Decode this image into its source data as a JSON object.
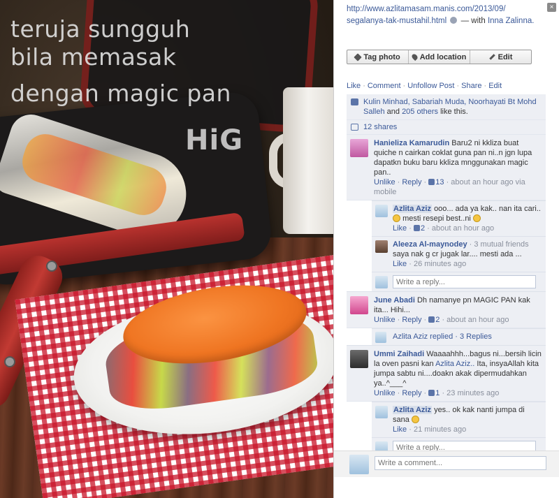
{
  "photo": {
    "line1": "teruja sungguh",
    "line2": "bila memasak",
    "line3": "dengan magic pan",
    "watermark": "HiG"
  },
  "caption": {
    "url_part1": "http://www.azlitamasam.manis.com/2013/09/",
    "url_part2": "segalanya-tak-mustahil.html",
    "with_text": "— with",
    "tagged": "Inna Zalinna."
  },
  "buttons": {
    "tag": "Tag photo",
    "location": "Add location",
    "edit": "Edit"
  },
  "actions": [
    "Like",
    "Comment",
    "Unfollow Post",
    "Share",
    "Edit"
  ],
  "likes": {
    "names": "Kulin Minhad, Sabariah Muda, Noorhayati Bt Mohd Salleh",
    "and": "and",
    "others": "205 others",
    "suffix": "like this."
  },
  "shares": "12 shares",
  "comments": [
    {
      "name": "Hanieliza Kamarudin",
      "text": "Baru2 ni kkliza buat quiche n cairkan coklat guna pan ni..n jgn lupa dapatkn buku baru kkliza mnggunakan magic pan..",
      "unlike": "Unlike",
      "reply": "Reply",
      "likes": "13",
      "time": "about an hour ago via mobile",
      "replies": [
        {
          "name": "Azlita Aziz",
          "text1": "ooo... ada ya kak.. nan ita cari..",
          "text2": "mesti resepi best..ni",
          "like": "Like",
          "likes": "2",
          "time": "about an hour ago"
        },
        {
          "name": "Aleeza Al-maynodey",
          "mutual": "· 3 mutual friends",
          "text": "saya nak g cr jugak lar.... mesti ada ...",
          "like": "Like",
          "time": "26 minutes ago"
        }
      ],
      "reply_placeholder": "Write a reply..."
    },
    {
      "name": "June Abadi",
      "text": "Dh namanye pn MAGIC PAN kak ita... Hihi...",
      "unlike": "Unlike",
      "reply": "Reply",
      "likes": "2",
      "time": "about an hour ago",
      "replied_text": "Azlita Aziz replied · 3 Replies"
    },
    {
      "name": "Ummi Zaihadi",
      "text1": "Waaaahhh...bagus ni...bersih licin la oven pasni kan",
      "mention": "Azlita Aziz..",
      "text2": "Ita, insyaAllah kita jumpa sabtu ni....doakn akak dipermudahkan ya..^___^",
      "unlike": "Unlike",
      "reply": "Reply",
      "likes": "1",
      "time": "23 minutes ago",
      "replies": [
        {
          "name": "Azlita Aziz",
          "text": "yes.. ok kak nanti jumpa di sana",
          "like": "Like",
          "time": "21 minutes ago"
        }
      ],
      "reply_placeholder": "Write a reply..."
    }
  ],
  "comment_placeholder": "Write a comment...",
  "close_icon": "×",
  "colors": {
    "link": "#3b5998",
    "comment_bg": "#edeff4",
    "meta": "#898f9c"
  }
}
